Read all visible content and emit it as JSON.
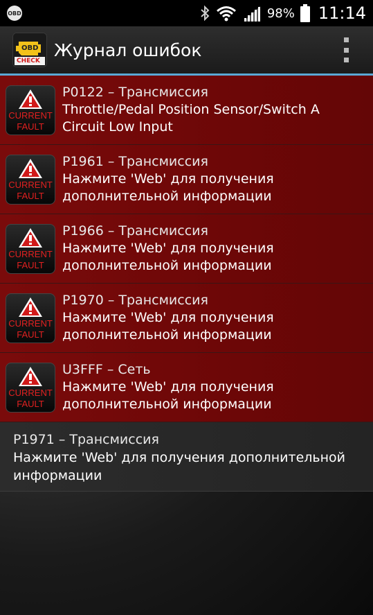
{
  "status_bar": {
    "left_icon": "obd-app-icon",
    "left_icon_text": "OBD",
    "battery_percent": "98%",
    "time": "11:14"
  },
  "action_bar": {
    "logo_text_top": "OBD",
    "logo_text_bottom": "CHECK",
    "title": "Журнал ошибок"
  },
  "badge": {
    "line1": "CURRENT",
    "line2": "FAULT"
  },
  "faults": [
    {
      "code": "P0122 – Трансмиссия",
      "desc_line1": "Throttle/Pedal Position Sensor/Switch A",
      "desc_line2": "Circuit Low Input",
      "current": true
    },
    {
      "code": "P1961 – Трансмиссия",
      "desc_line1": "Нажмите 'Web' для получения",
      "desc_line2": "дополнительной информации",
      "current": true
    },
    {
      "code": "P1966 – Трансмиссия",
      "desc_line1": "Нажмите 'Web' для получения",
      "desc_line2": "дополнительной информации",
      "current": true
    },
    {
      "code": "P1970 – Трансмиссия",
      "desc_line1": "Нажмите 'Web' для получения",
      "desc_line2": "дополнительной информации",
      "current": true
    },
    {
      "code": "U3FFF – Сеть",
      "desc_line1": "Нажмите 'Web' для получения",
      "desc_line2": "дополнительной информации",
      "current": true
    },
    {
      "code": "P1971 – Трансмиссия",
      "desc_line1": "Нажмите 'Web' для получения дополнительной",
      "desc_line2": "информации",
      "current": false
    }
  ],
  "colors": {
    "fault_row_bg": "#6d0707",
    "plain_row_bg": "#282828",
    "accent_line": "#5aa9d6",
    "badge_text": "#e02020"
  }
}
